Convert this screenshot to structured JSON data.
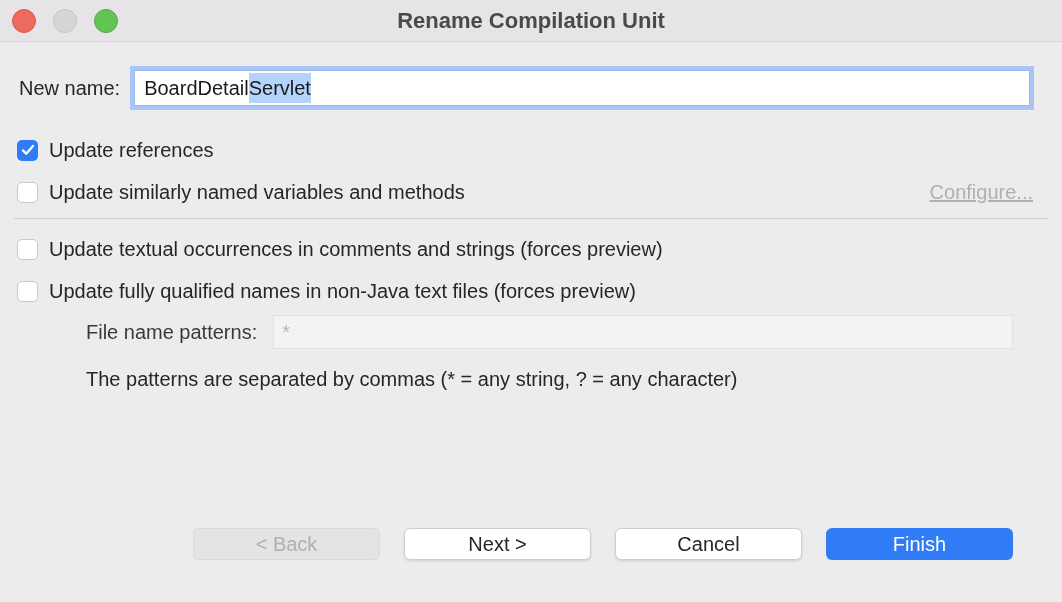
{
  "window": {
    "title": "Rename Compilation Unit"
  },
  "new_name": {
    "label": "New name:",
    "value": "BoardDetail",
    "selected_text": "Servlet"
  },
  "options": [
    {
      "label": "Update references",
      "checked": true
    },
    {
      "label": "Update similarly named variables and methods",
      "checked": false,
      "link": {
        "label": "Configure...",
        "disabled": true
      }
    }
  ],
  "text_options": [
    {
      "label": "Update textual occurrences in comments and strings (forces preview)",
      "checked": false
    },
    {
      "label": "Update fully qualified names in non-Java text files (forces preview)",
      "checked": false
    }
  ],
  "file_patterns": {
    "label": "File name patterns:",
    "placeholder": "*",
    "disabled": true,
    "hint": "The patterns are separated by commas (* = any string, ? = any character)"
  },
  "buttons": [
    {
      "label": "< Back",
      "kind": "normal",
      "disabled": true
    },
    {
      "label": "Next >",
      "kind": "normal",
      "disabled": false
    },
    {
      "label": "Cancel",
      "kind": "normal",
      "disabled": false
    },
    {
      "label": "Finish",
      "kind": "primary",
      "disabled": false
    }
  ]
}
